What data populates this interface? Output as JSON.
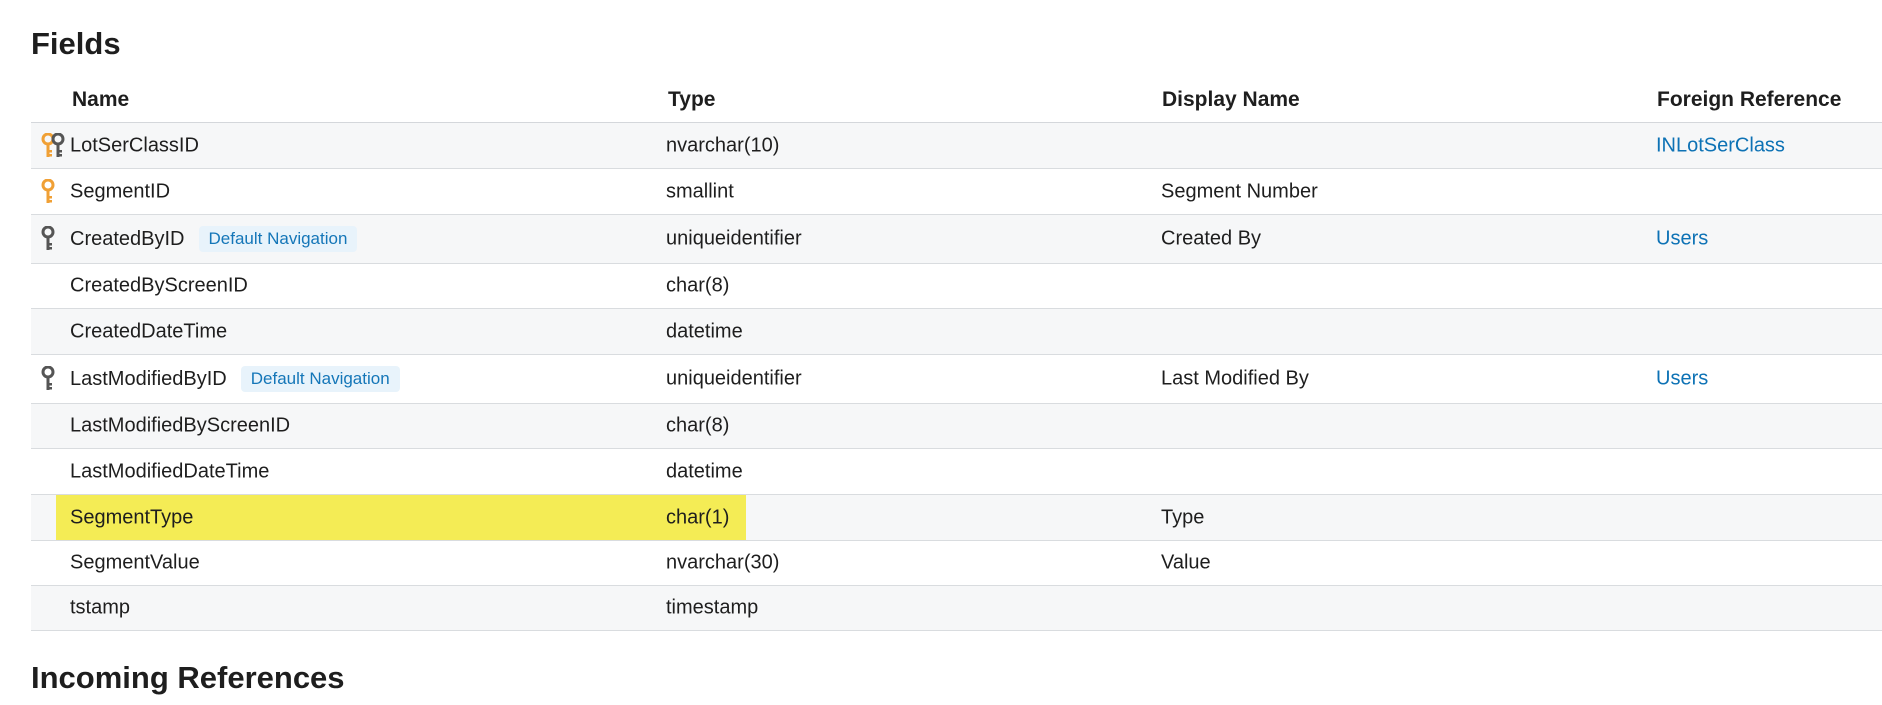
{
  "fields_heading": "Fields",
  "columns": {
    "name": "Name",
    "type": "Type",
    "display_name": "Display Name",
    "foreign_reference": "Foreign Reference"
  },
  "rows": [
    {
      "name": "LotSerClassID",
      "type": "nvarchar(10)",
      "display_name": "",
      "foreign_reference": "INLotSerClass",
      "badge": "",
      "keys": [
        "key-orange",
        "key-dark"
      ]
    },
    {
      "name": "SegmentID",
      "type": "smallint",
      "display_name": "Segment Number",
      "foreign_reference": "",
      "badge": "",
      "keys": [
        "key-orange"
      ]
    },
    {
      "name": "CreatedByID",
      "type": "uniqueidentifier",
      "display_name": "Created By",
      "foreign_reference": "Users",
      "badge": "Default Navigation",
      "keys": [
        "key-dark"
      ]
    },
    {
      "name": "CreatedByScreenID",
      "type": "char(8)",
      "display_name": "",
      "foreign_reference": "",
      "badge": "",
      "keys": []
    },
    {
      "name": "CreatedDateTime",
      "type": "datetime",
      "display_name": "",
      "foreign_reference": "",
      "badge": "",
      "keys": []
    },
    {
      "name": "LastModifiedByID",
      "type": "uniqueidentifier",
      "display_name": "Last Modified By",
      "foreign_reference": "Users",
      "badge": "Default Navigation",
      "keys": [
        "key-dark"
      ]
    },
    {
      "name": "LastModifiedByScreenID",
      "type": "char(8)",
      "display_name": "",
      "foreign_reference": "",
      "badge": "",
      "keys": []
    },
    {
      "name": "LastModifiedDateTime",
      "type": "datetime",
      "display_name": "",
      "foreign_reference": "",
      "badge": "",
      "keys": []
    },
    {
      "name": "SegmentType",
      "type": "char(1)",
      "display_name": "Type",
      "foreign_reference": "",
      "badge": "",
      "keys": [],
      "highlighted": true
    },
    {
      "name": "SegmentValue",
      "type": "nvarchar(30)",
      "display_name": "Value",
      "foreign_reference": "",
      "badge": "",
      "keys": []
    },
    {
      "name": "tstamp",
      "type": "timestamp",
      "display_name": "",
      "foreign_reference": "",
      "badge": "",
      "keys": []
    }
  ],
  "incoming_heading": "Incoming References",
  "colors": {
    "link": "#0d72b5",
    "highlight": "#f4ec55",
    "key_orange": "#f0a035",
    "key_dark": "#555555",
    "badge_bg": "#e8f3fb"
  }
}
